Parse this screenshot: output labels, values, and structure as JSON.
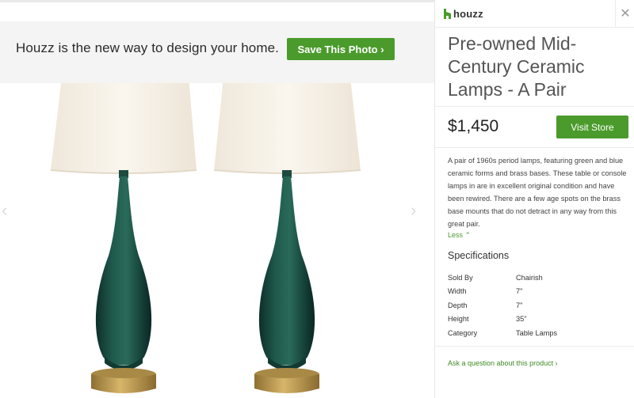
{
  "banner": {
    "text": "Houzz is the new way to design your home.",
    "save_button": "Save This Photo ›"
  },
  "header": {
    "logo_text": "houzz",
    "close_symbol": "✕"
  },
  "product": {
    "title": "Pre-owned Mid-Century Ceramic Lamps - A Pair",
    "price": "$1,450",
    "visit_store": "Visit Store",
    "description": "A pair of 1960s period lamps, featuring green and blue ceramic forms and brass bases. These table or console lamps in are in excellent original condition and have been rewired. There are a few age spots on the brass base mounts that do not detract in any way from this great pair.",
    "less_link": "Less ⌃"
  },
  "specifications": {
    "title": "Specifications",
    "rows": [
      {
        "label": "Sold By",
        "value": "Chairish"
      },
      {
        "label": "Width",
        "value": "7\""
      },
      {
        "label": "Depth",
        "value": "7\""
      },
      {
        "label": "Height",
        "value": "35\""
      },
      {
        "label": "Category",
        "value": "Table Lamps"
      }
    ]
  },
  "ask_link": "Ask a question about this product ›",
  "colors": {
    "accent_green": "#4a9b2b",
    "lamp_body": "#1a4a3f",
    "shade": "#f6f0e6",
    "brass": "#b8944a"
  }
}
